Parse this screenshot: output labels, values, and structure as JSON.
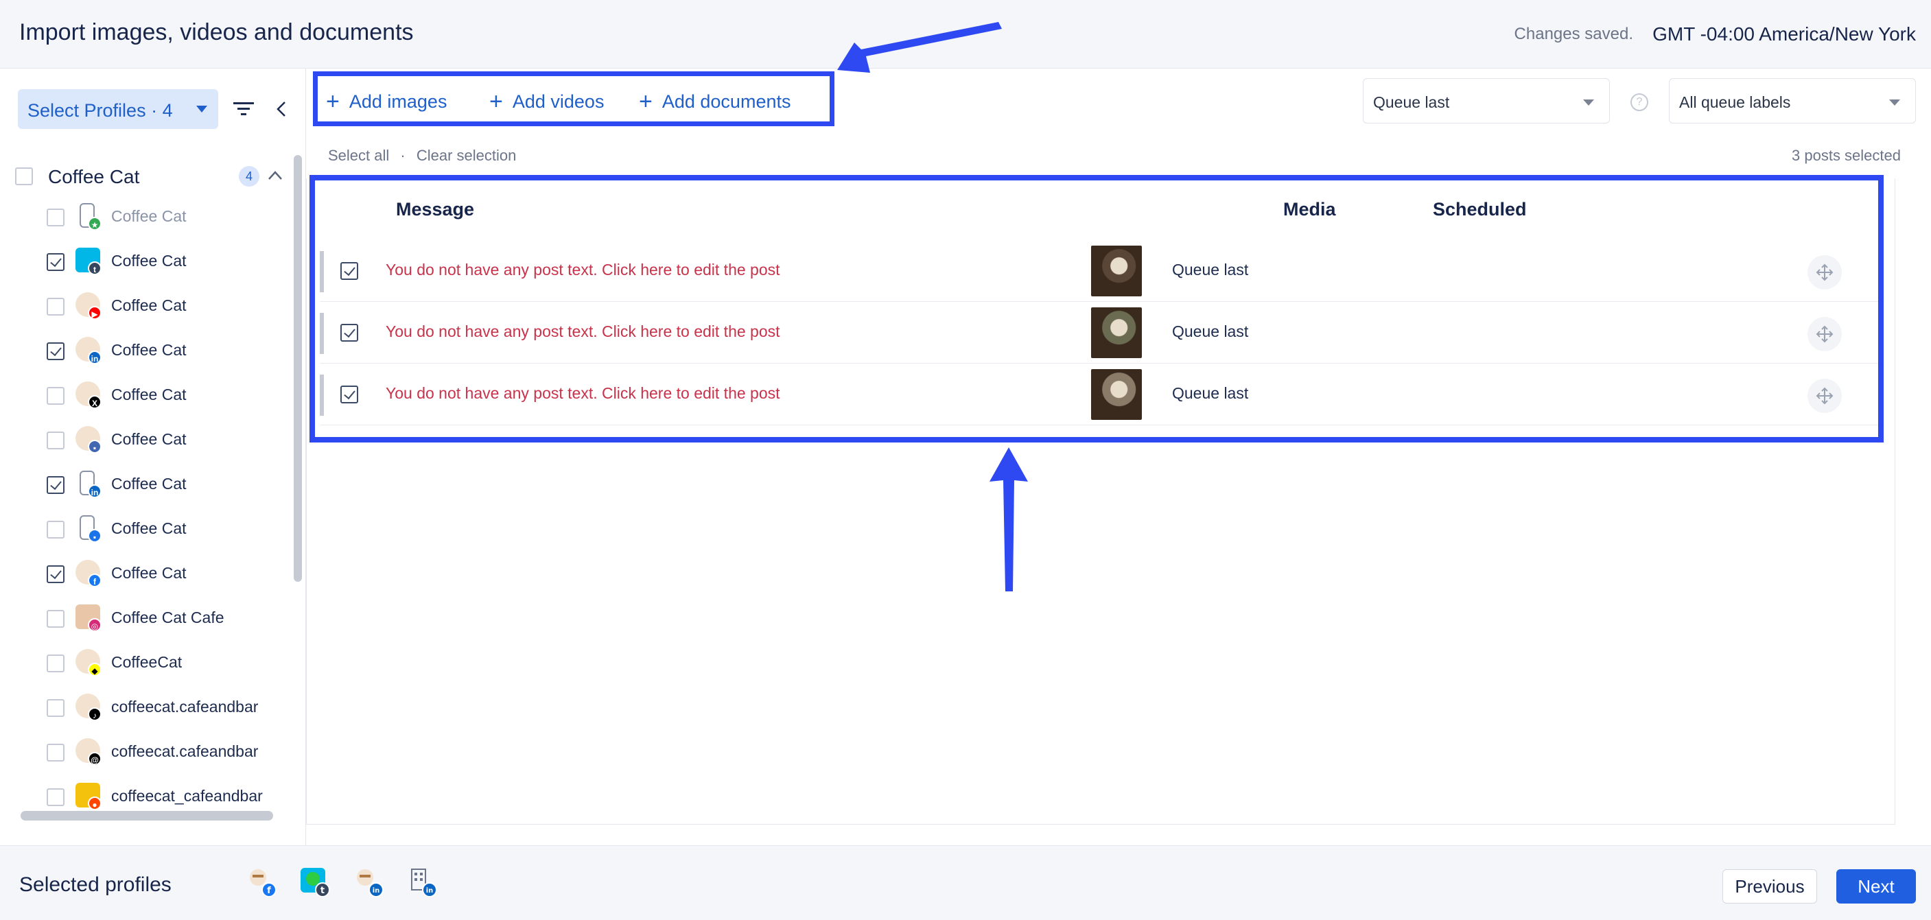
{
  "header": {
    "title": "Import images, videos and documents",
    "saved_status": "Changes saved.",
    "timezone": "GMT -04:00 America/New York"
  },
  "sidebar": {
    "select_profiles_label": "Select Profiles · 4",
    "group": {
      "name": "Coffee Cat",
      "count": "4"
    },
    "profiles": [
      {
        "name": "Coffee Cat",
        "checked": false,
        "network": "google-business",
        "dim": true
      },
      {
        "name": "Coffee Cat",
        "checked": true,
        "network": "tumblr"
      },
      {
        "name": "Coffee Cat",
        "checked": false,
        "network": "youtube"
      },
      {
        "name": "Coffee Cat",
        "checked": true,
        "network": "linkedin"
      },
      {
        "name": "Coffee Cat",
        "checked": false,
        "network": "x"
      },
      {
        "name": "Coffee Cat",
        "checked": false,
        "network": "facebook-page"
      },
      {
        "name": "Coffee Cat",
        "checked": true,
        "network": "linkedin-page"
      },
      {
        "name": "Coffee Cat",
        "checked": false,
        "network": "google-page"
      },
      {
        "name": "Coffee Cat",
        "checked": true,
        "network": "facebook"
      },
      {
        "name": "Coffee Cat Cafe",
        "checked": false,
        "network": "instagram"
      },
      {
        "name": "CoffeeCat",
        "checked": false,
        "network": "snapchat"
      },
      {
        "name": "coffeecat.cafeandbar",
        "checked": false,
        "network": "tiktok"
      },
      {
        "name": "coffeecat.cafeandbar",
        "checked": false,
        "network": "threads"
      },
      {
        "name": "coffeecat_cafeandbar",
        "checked": false,
        "network": "reddit"
      }
    ]
  },
  "toolbar": {
    "add_images": "Add images",
    "add_videos": "Add videos",
    "add_documents": "Add documents",
    "queue_select": "Queue last",
    "labels_select": "All queue labels",
    "help": "?"
  },
  "selection": {
    "select_all": "Select all",
    "separator": "·",
    "clear_selection": "Clear selection",
    "posts_selected": "3 posts selected"
  },
  "table": {
    "headers": {
      "message": "Message",
      "media": "Media",
      "scheduled": "Scheduled"
    },
    "rows": [
      {
        "message": "You do not have any post text. Click here to edit the post",
        "scheduled": "Queue last",
        "thumb_color": "#5a4636"
      },
      {
        "message": "You do not have any post text. Click here to edit the post",
        "scheduled": "Queue last",
        "thumb_color": "#6b6b52"
      },
      {
        "message": "You do not have any post text. Click here to edit the post",
        "scheduled": "Queue last",
        "thumb_color": "#8a7a68"
      }
    ]
  },
  "footer": {
    "selected_profiles_label": "Selected profiles",
    "previous": "Previous",
    "next": "Next"
  },
  "colors": {
    "annotation_blue": "#2e49f2",
    "primary": "#1f5fe0",
    "error_text": "#c8324a"
  }
}
